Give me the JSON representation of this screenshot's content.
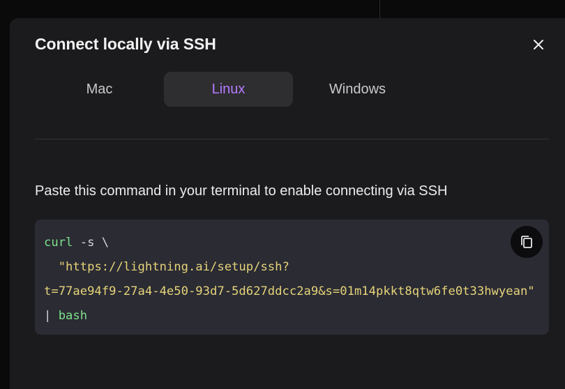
{
  "modal": {
    "title": "Connect locally via SSH",
    "close_icon": "close-icon"
  },
  "tabs": [
    {
      "label": "Mac",
      "active": false
    },
    {
      "label": "Linux",
      "active": true
    },
    {
      "label": "Windows",
      "active": false
    }
  ],
  "instruction": "Paste this command in your terminal to enable connecting via SSH",
  "code": {
    "line1_cmd": "curl",
    "line1_rest": " -s \\",
    "line2_indent": "  ",
    "line2_str": "\"https://lightning.ai/setup/ssh?",
    "line3_str": "t=77ae94f9-27a4-4e50-93d7-5d627ddcc2a9&s=01m14pkkt8qtw6fe0t33hwyean\"",
    "line4_pipe": "| ",
    "line4_cmd": "bash",
    "copy_icon": "copy-icon"
  },
  "colors": {
    "accent": "#b57aff",
    "code_command": "#7ee08a",
    "code_string": "#e6d37a",
    "modal_background": "#1b1b1d",
    "code_background": "#2a2b33"
  }
}
